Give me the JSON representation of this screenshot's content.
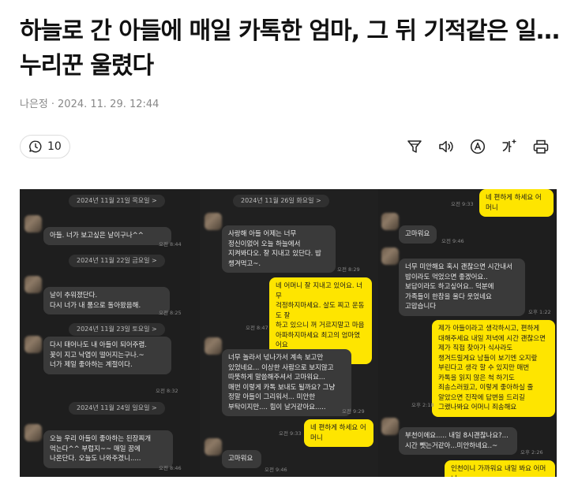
{
  "article": {
    "title": "하늘로 간 아들에 매일 카톡한 엄마, 그 뒤 기적같은 일…누리꾼 울렸다",
    "author": "나은정",
    "date": "2024. 11. 29. 12:44",
    "comment_count": "10"
  },
  "toolbar": {
    "icons": [
      "filter-icon",
      "speaker-icon",
      "translate-icon",
      "font-size-icon",
      "print-icon"
    ]
  },
  "chat": {
    "col1": {
      "date1": "2024년 11월 21일 목요일 >",
      "msg1": "아들. 너가 보고싶은 날이구나^^",
      "time1": "오전 8:44",
      "date2": "2024년 11월 22일 금요일 >",
      "msg2": "날이 추워졌단다.\n다시 너가 내 품으로 돌아왔음해.",
      "time2": "오전 8:25",
      "date3": "2024년 11월 23일 토요일 >",
      "msg3": "다시 태어나도 내 아들이 되어주렴.\n꽃이 지고 낙엽이 떨어지는구나.~\n너가 제일 좋아하는 계절이다.",
      "time3": "오전 8:32",
      "date4": "2024년 11월 24일 일요일 >",
      "msg4": "오늘 우리 아들이 좋아하는 된장찌개\n먹는다^^ 부럽지~~ 매일 꿈에\n나온단다. 오늘도 나와주겠니.....",
      "time4": "오전 8:46"
    },
    "col2": {
      "date1": "2024년 11월 26일 화요일 >",
      "msg1": "사랑해 아들 어제는 너무\n정신이없어 오늘 하늘에서\n지켜봐다오. 잘 지내고 있단다. 밥\n챙겨먹고~.",
      "time1": "오전 8:29",
      "msg2": "네 어머니 잘 지내고 있어요. 너무\n걱정하지마세요. 살도 찌고 운동도 잘\n하고 있으니 꺼 거르지말고 마음\n아파하지마세요 최고의 엄마였어요\n저도 사랑해요 엄마",
      "time2": "오전 8:47",
      "msg3": "너무 놀라서 넋나가서 계속 보고만\n있었네요... 이상한 사람으로 보지않고\n따뜻하게 말씀해주셔서 고마워요...\n매번 이렇게 카톡 보내도 될까요? 그냥\n정말 아들이 그리워서... 미안한\n부탁이지만.... 힘이 날거같아요.....",
      "time3": "오전 9:29",
      "msg4": "네 편하게 하세요 어머니",
      "time4": "오전 9:33",
      "msg5": "고마워요",
      "time5": "오전 9:46"
    },
    "col3": {
      "msg1": "네 편하게 하세요 어머니",
      "time1": "오전 9:33",
      "msg2": "고마워요",
      "time2": "오전 9:46",
      "msg3": "너무 미안해요 혹시 괜찮으면 시간내서\n밥이라도 먹었으면 좋겠어요..\n보답이라도 하고싶어요.. 덕분에\n가족들이 한참을 울다 웃었네요\n고맙습니다",
      "time3": "오후 1:22",
      "msg4": "제가 아들이라고 생각하시고, 편하게\n대해주세요 내일 저녁에 시간 괜찮으면\n제가 직접 찾아가 식사라도\n챙겨드릴게요 남들이 보기엔 오지랖\n부린다고 생각 할 수 있지만 매번\n카톡을 읽지 않은 척 하기도\n죄송스러웠고, 이렇게 좋아하실 줄\n알았으면 진작에 답변을 드리길\n그랬나봐요 어머니 죄송해요",
      "time4": "오후 2:18",
      "msg5": "부천이에요..... 내일 8시괜찮나요?...\n시간 뺏는거같아...미안하네요..~",
      "time5": "오후 2:26",
      "msg6": "인천이니 가까워요 내일 봐요 어머니"
    }
  },
  "colors": {
    "accent_bubble": "#fee500",
    "chat_bg": "#1e1e1e",
    "other_bubble": "#3a3a3a"
  }
}
